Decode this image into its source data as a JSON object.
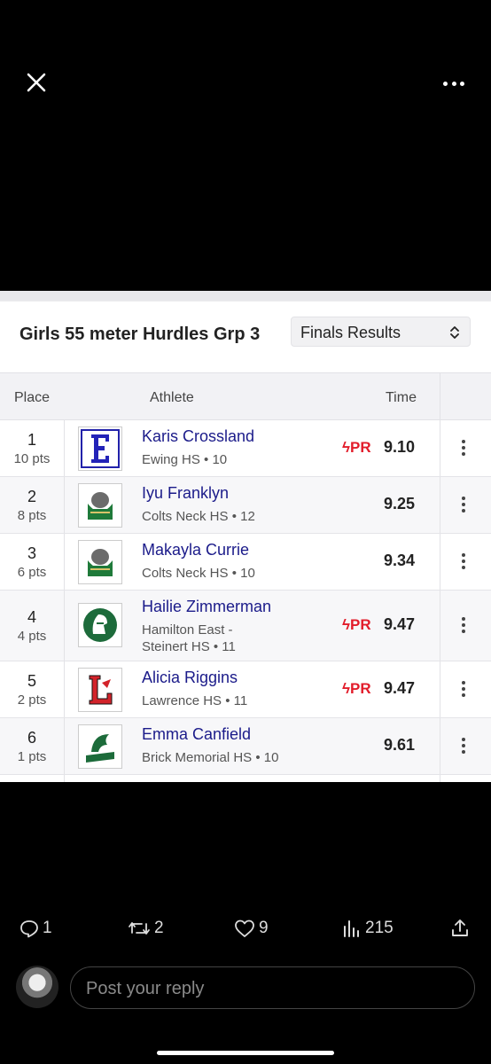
{
  "top_bar": {
    "close_icon": "close-icon",
    "more_icon": "more-icon"
  },
  "card": {
    "title": "Girls 55 meter Hurdles Grp 3",
    "round_select": {
      "value": "Finals Results"
    },
    "headers": {
      "place": "Place",
      "athlete": "Athlete",
      "time": "Time"
    },
    "rows": [
      {
        "place": "1",
        "pts": "10 pts",
        "name": "Karis Crossland",
        "school": "Ewing HS • 10",
        "pr": "PR",
        "time": "9.10",
        "logo": "ewing-logo"
      },
      {
        "place": "2",
        "pts": "8 pts",
        "name": "Iyu Franklyn",
        "school": "Colts Neck HS • 12",
        "pr": "",
        "time": "9.25",
        "logo": "colts-neck-logo"
      },
      {
        "place": "3",
        "pts": "6 pts",
        "name": "Makayla Currie",
        "school": "Colts Neck HS • 10",
        "pr": "",
        "time": "9.34",
        "logo": "colts-neck-logo"
      },
      {
        "place": "4",
        "pts": "4 pts",
        "name": "Hailie Zimmerman",
        "school_line1": "Hamilton East -",
        "school_line2": "Steinert HS • 11",
        "pr": "PR",
        "time": "9.47",
        "logo": "steinert-logo"
      },
      {
        "place": "5",
        "pts": "2 pts",
        "name": "Alicia Riggins",
        "school": "Lawrence HS • 11",
        "pr": "PR",
        "time": "9.47",
        "logo": "lawrence-logo"
      },
      {
        "place": "6",
        "pts": "1 pts",
        "name": "Emma Canfield",
        "school": "Brick Memorial HS • 10",
        "pr": "",
        "time": "9.61",
        "logo": "brick-memorial-logo"
      }
    ]
  },
  "actions": {
    "replies": "1",
    "reposts": "2",
    "likes": "9",
    "views": "215"
  },
  "reply": {
    "placeholder": "Post your reply"
  },
  "colors": {
    "pr_red": "#e21c2a",
    "athlete_blue": "#1b1b8a",
    "background": "#000000"
  }
}
